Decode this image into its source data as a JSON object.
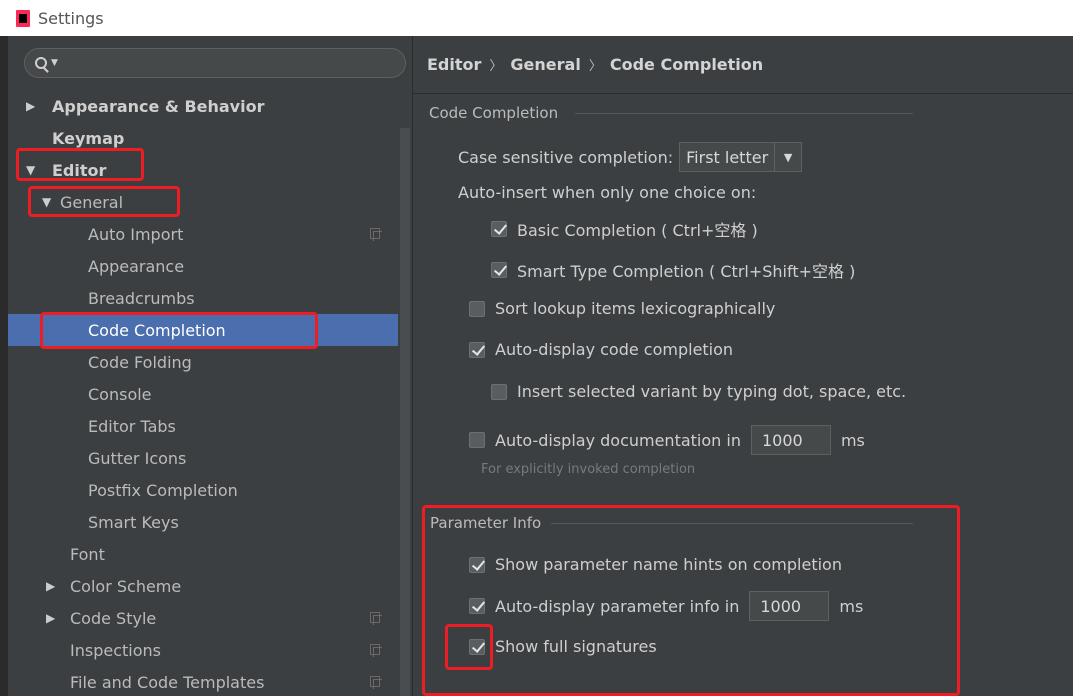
{
  "window": {
    "title": "Settings"
  },
  "colors": {
    "accent": "#4b6eaf",
    "highlight": "#ee1d23"
  },
  "sidebar": {
    "tree": [
      {
        "label": "Appearance & Behavior",
        "arrow": "▶"
      },
      {
        "label": "Keymap"
      },
      {
        "label": "Editor",
        "arrow": "▼"
      },
      {
        "label": "General",
        "arrow": "▼"
      },
      {
        "label": "Auto Import"
      },
      {
        "label": "Appearance"
      },
      {
        "label": "Breadcrumbs"
      },
      {
        "label": "Code Completion"
      },
      {
        "label": "Code Folding"
      },
      {
        "label": "Console"
      },
      {
        "label": "Editor Tabs"
      },
      {
        "label": "Gutter Icons"
      },
      {
        "label": "Postfix Completion"
      },
      {
        "label": "Smart Keys"
      },
      {
        "label": "Font"
      },
      {
        "label": "Color Scheme",
        "arrow": "▶"
      },
      {
        "label": "Code Style",
        "arrow": "▶"
      },
      {
        "label": "Inspections"
      },
      {
        "label": "File and Code Templates"
      }
    ]
  },
  "breadcrumb": [
    "Editor",
    "General",
    "Code Completion"
  ],
  "breadcrumb_sep": "〉",
  "code_completion": {
    "group_title": "Code Completion",
    "case_sensitive_label": "Case sensitive completion:",
    "case_sensitive_value": "First letter",
    "auto_insert_label": "Auto-insert when only one choice on:",
    "basic_completion": {
      "label": "Basic Completion ( Ctrl+空格 )",
      "checked": true
    },
    "smart_type_completion": {
      "label": "Smart Type Completion ( Ctrl+Shift+空格 )",
      "checked": true
    },
    "sort_lookup": {
      "label": "Sort lookup items lexicographically",
      "checked": false
    },
    "auto_display_code": {
      "label": "Auto-display code completion",
      "checked": true
    },
    "insert_selected": {
      "label": "Insert selected variant by typing dot, space, etc.",
      "checked": false
    },
    "auto_display_doc": {
      "label": "Auto-display documentation in",
      "checked": false,
      "value": "1000",
      "unit": "ms"
    },
    "doc_hint": "For explicitly invoked completion"
  },
  "parameter_info": {
    "group_title": "Parameter Info",
    "show_hints": {
      "label": "Show parameter name hints on completion",
      "checked": true
    },
    "auto_display_param": {
      "label": "Auto-display parameter info in",
      "checked": true,
      "value": "1000",
      "unit": "ms"
    },
    "show_full_signatures": {
      "label": "Show full signatures",
      "checked": true
    }
  }
}
